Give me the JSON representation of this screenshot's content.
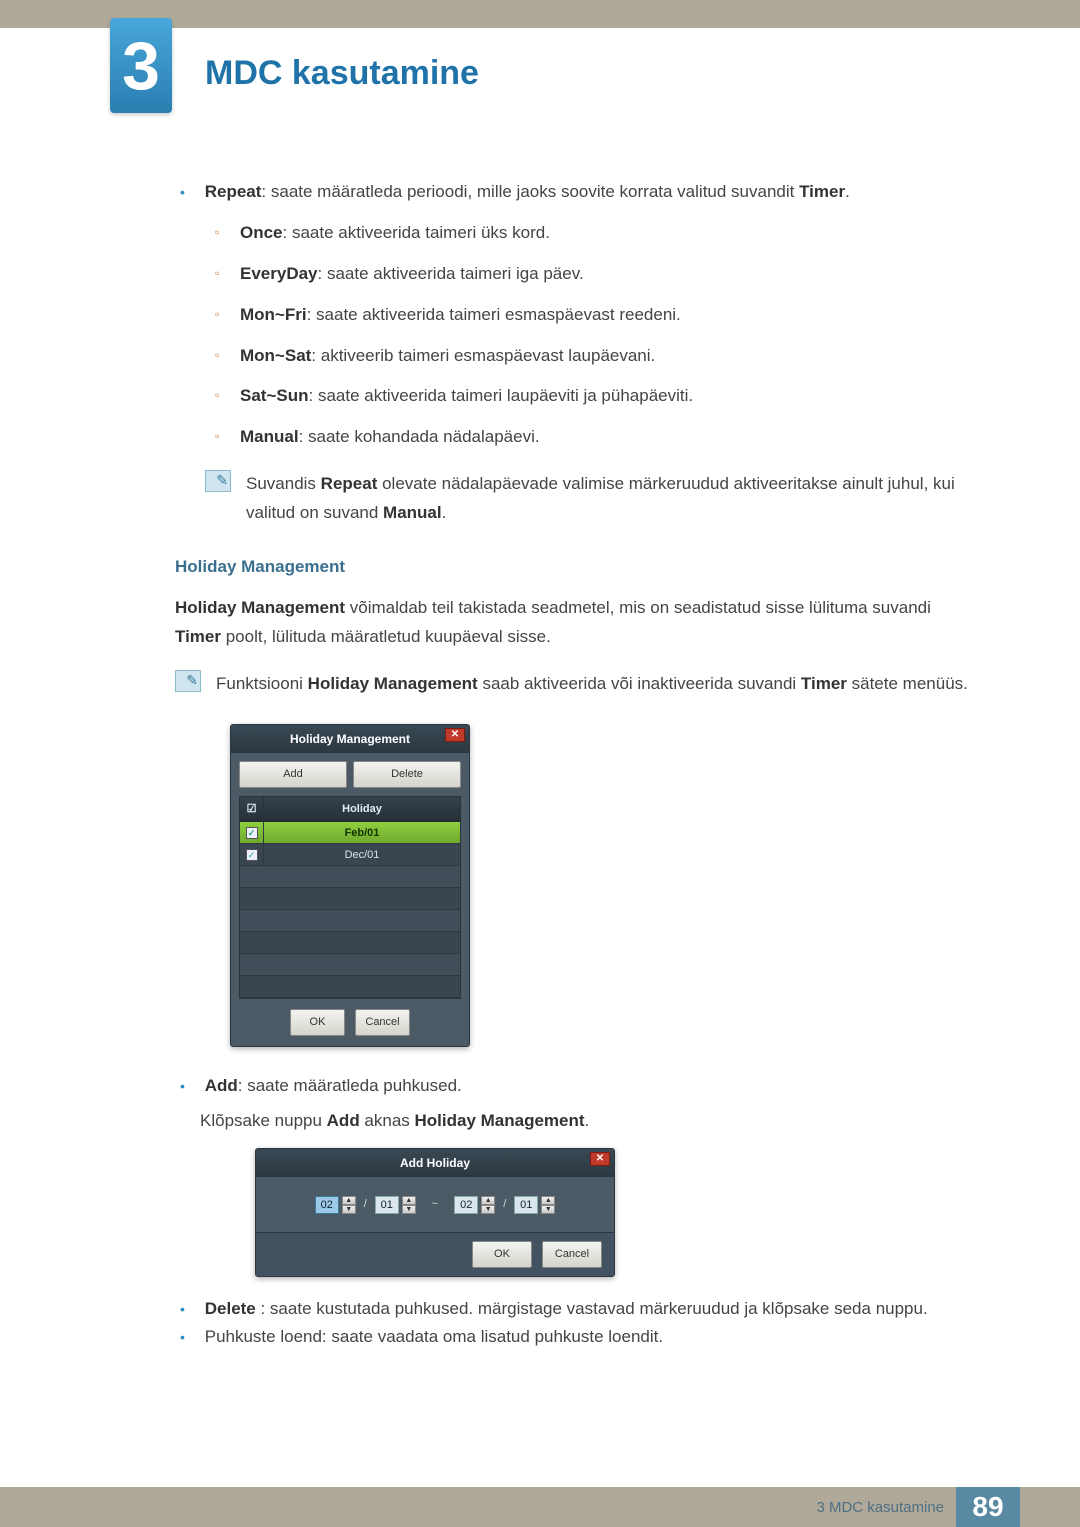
{
  "chapter": {
    "number": "3",
    "title": "MDC kasutamine"
  },
  "repeat": {
    "label": "Repeat",
    "desc_tail": ": saate määratleda perioodi, mille jaoks soovite korrata valitud suvandit ",
    "desc_tail2": "Timer",
    "options": {
      "once": {
        "label": "Once",
        "desc": ": saate aktiveerida taimeri üks kord."
      },
      "everyday": {
        "label": "EveryDay",
        "desc": ": saate aktiveerida taimeri iga päev."
      },
      "monfri": {
        "label": "Mon~Fri",
        "desc": ": saate aktiveerida taimeri esmaspäevast reedeni."
      },
      "monsat": {
        "label": "Mon~Sat",
        "desc": ": aktiveerib taimeri esmaspäevast laupäevani."
      },
      "satsun": {
        "label": "Sat~Sun",
        "desc": ": saate aktiveerida taimeri laupäeviti ja pühapäeviti."
      },
      "manual": {
        "label": "Manual",
        "desc": ": saate kohandada nädalapäevi."
      }
    },
    "note_a": "Suvandis ",
    "note_b": "Repeat",
    "note_c": " olevate nädalapäevade valimise märkeruudud aktiveeritakse ainult juhul, kui valitud on suvand ",
    "note_d": "Manual",
    "note_e": "."
  },
  "holiday": {
    "heading": "Holiday Management",
    "para_a": "Holiday Management",
    "para_b": " võimaldab teil takistada seadmetel, mis on seadistatud sisse lülituma suvandi ",
    "para_c": "Timer",
    "para_d": " poolt, lülituda määratletud kuupäeval sisse.",
    "note_a": "Funktsiooni ",
    "note_b": "Holiday Management",
    "note_c": " saab aktiveerida või inaktiveerida suvandi ",
    "note_d": "Timer",
    "note_e": " sätete menüüs."
  },
  "dlg": {
    "title": "Holiday Management",
    "add": "Add",
    "del": "Delete",
    "col": "Holiday",
    "row1": "Feb/01",
    "row2": "Dec/01",
    "ok": "OK",
    "cancel": "Cancel",
    "close": "✕"
  },
  "add_section": {
    "label": "Add",
    "desc": ": saate määratleda puhkused.",
    "para_a": "Klõpsake nuppu ",
    "para_b": "Add",
    "para_c": " aknas ",
    "para_d": "Holiday Management",
    "para_e": "."
  },
  "dlg2": {
    "title": "Add Holiday",
    "close": "✕",
    "v1": "02",
    "v2": "01",
    "sep": "/",
    "tilde": "~",
    "v3": "02",
    "v4": "01",
    "ok": "OK",
    "cancel": "Cancel"
  },
  "delete_section": {
    "label": "Delete",
    "desc": " : saate kustutada puhkused. märgistage vastavad märkeruudud ja klõpsake seda nuppu."
  },
  "list_section": {
    "text": "Puhkuste loend: saate vaadata oma lisatud puhkuste loendit."
  },
  "footer": {
    "text": "3 MDC kasutamine",
    "page": "89"
  }
}
